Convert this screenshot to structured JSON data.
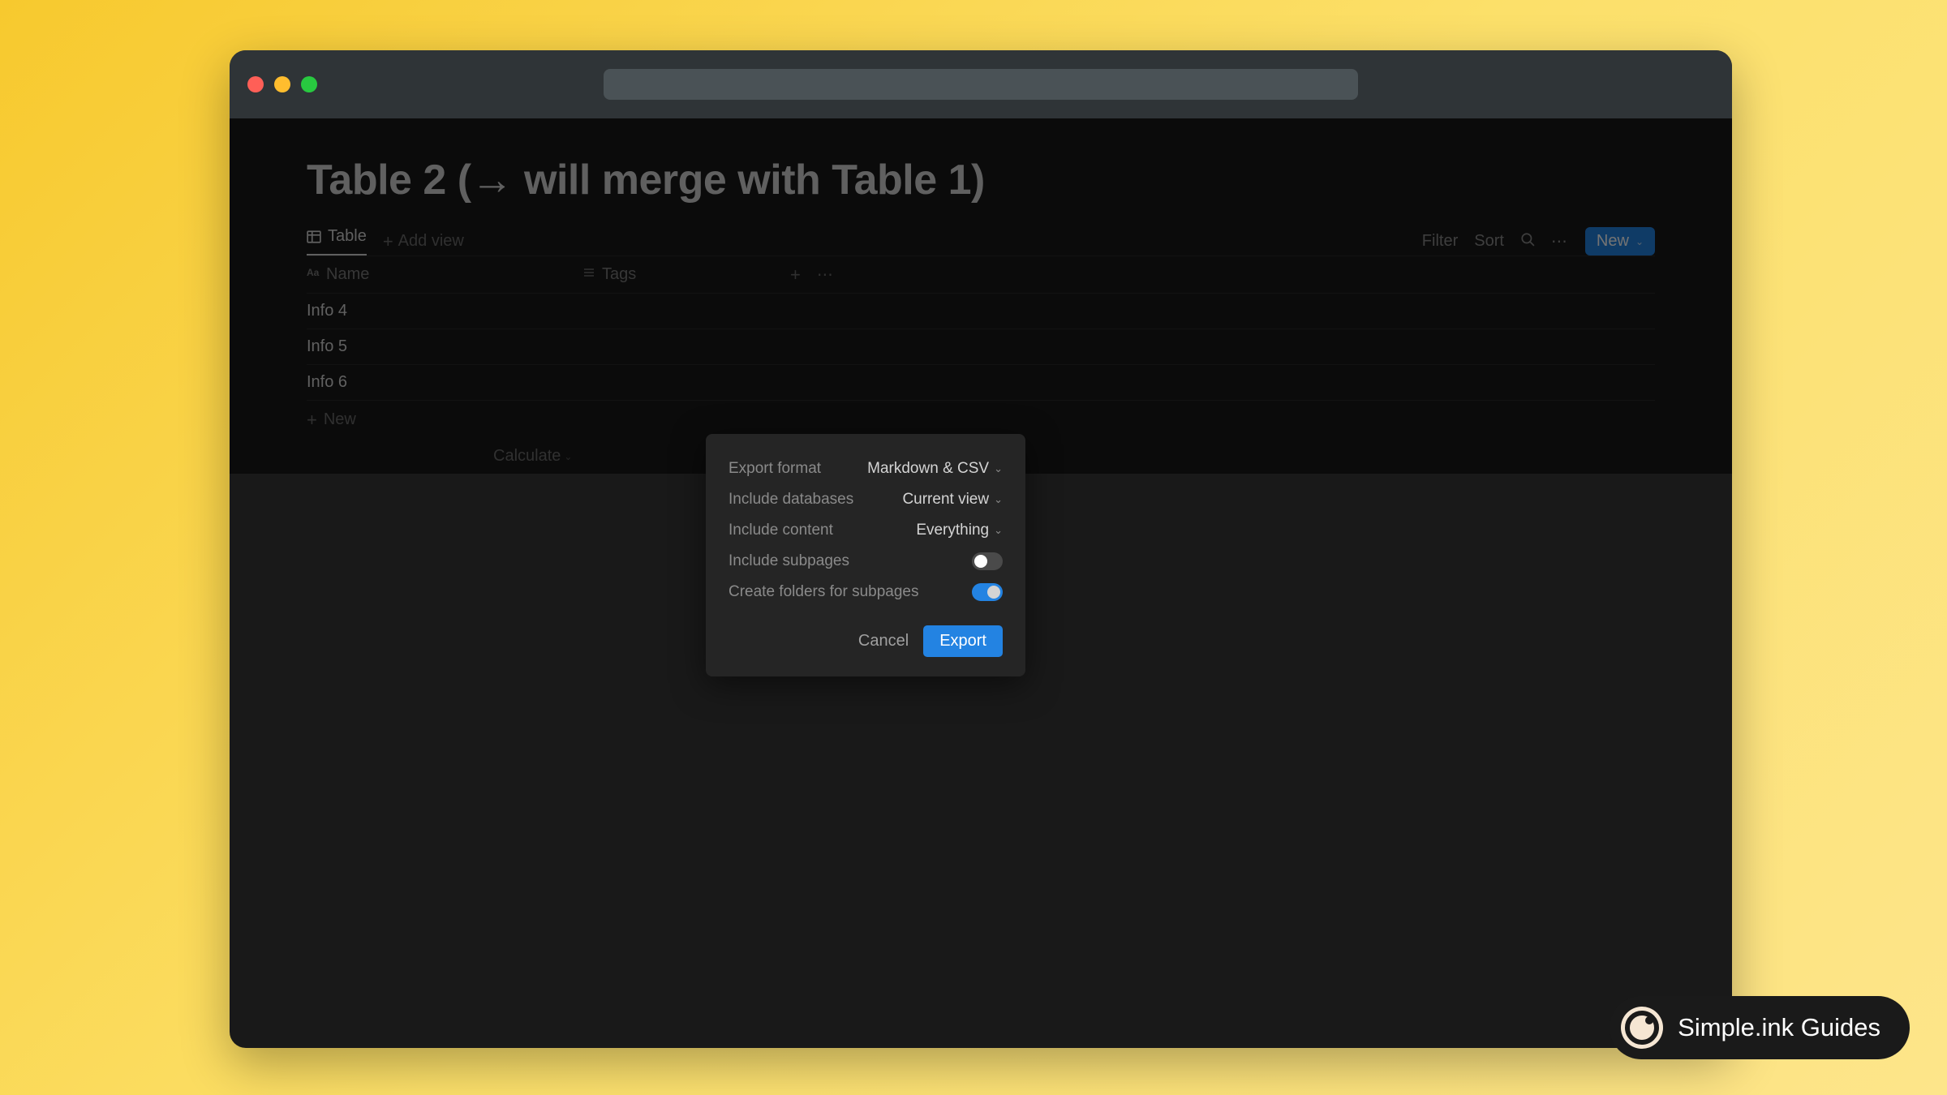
{
  "page": {
    "title": "Table 2   (→ will merge with Table 1)"
  },
  "views": {
    "current_tab": "Table",
    "add_view": "Add view"
  },
  "toolbar": {
    "filter": "Filter",
    "sort": "Sort",
    "new_button": "New"
  },
  "columns": {
    "name_header": "Name",
    "tags_header": "Tags"
  },
  "rows": [
    "Info 4",
    "Info 5",
    "Info 6"
  ],
  "new_row_label": "New",
  "calculate_label": "Calculate",
  "modal": {
    "export_format_label": "Export format",
    "export_format_value": "Markdown & CSV",
    "include_databases_label": "Include databases",
    "include_databases_value": "Current view",
    "include_content_label": "Include content",
    "include_content_value": "Everything",
    "include_subpages_label": "Include subpages",
    "create_folders_label": "Create folders for subpages",
    "cancel_button": "Cancel",
    "export_button": "Export"
  },
  "badge": {
    "text": "Simple.ink Guides"
  }
}
